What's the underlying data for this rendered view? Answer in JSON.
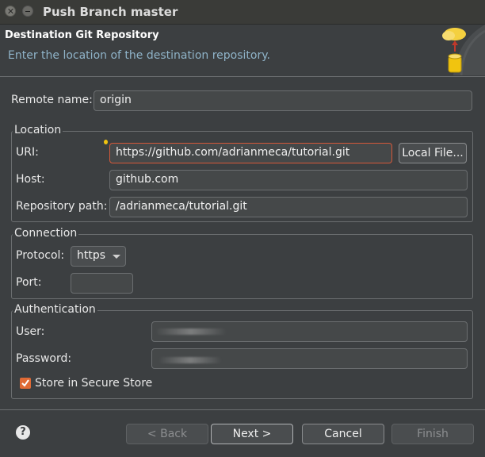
{
  "window": {
    "title": "Push Branch master"
  },
  "header": {
    "title": "Destination Git Repository",
    "subtitle": "Enter the location of the destination repository."
  },
  "remote": {
    "label": "Remote name:",
    "value": "origin"
  },
  "location": {
    "legend": "Location",
    "uri_label": "URI:",
    "uri_value": "https://github.com/adrianmeca/tutorial.git",
    "local_file_button": "Local File...",
    "host_label": "Host:",
    "host_value": "github.com",
    "path_label": "Repository path:",
    "path_value": "/adrianmeca/tutorial.git"
  },
  "connection": {
    "legend": "Connection",
    "protocol_label": "Protocol:",
    "protocol_value": "https",
    "port_label": "Port:",
    "port_value": ""
  },
  "authentication": {
    "legend": "Authentication",
    "user_label": "User:",
    "password_label": "Password:",
    "secure_store_label": "Store in Secure Store",
    "secure_store_checked": true
  },
  "footer": {
    "back": "< Back",
    "next": "Next >",
    "cancel": "Cancel",
    "finish": "Finish"
  },
  "icons": {
    "help": "help-icon",
    "banner": "git-push-banner-icon"
  },
  "colors": {
    "background": "#3c3f41",
    "accent_check": "#e06a35",
    "focus_border": "#d4583a",
    "subtitle": "#8fb3c8"
  }
}
